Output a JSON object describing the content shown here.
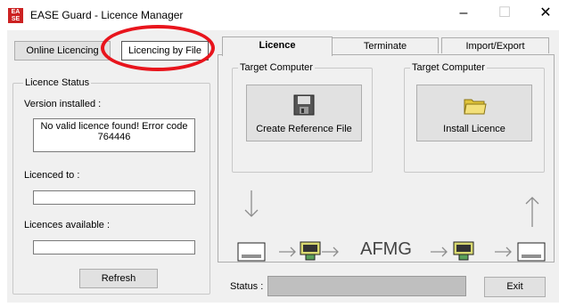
{
  "window": {
    "title": "EASE Guard - Licence Manager",
    "minimize": "–",
    "maximize": "☐",
    "close": "✕"
  },
  "mode_buttons": {
    "online": "Online Licencing",
    "file": "Licencing by File"
  },
  "licence_status": {
    "legend": "Licence Status",
    "version_label": "Version installed :",
    "version_value": "No valid licence found! Error code 764446",
    "licenced_to_label": "Licenced to :",
    "licenced_to_value": "",
    "available_label": "Licences available :",
    "available_value": "",
    "refresh_label": "Refresh"
  },
  "tabs": [
    "Licence",
    "Terminate",
    "Import/Export"
  ],
  "licence_panel": {
    "left_group_legend": "Target Computer",
    "right_group_legend": "Target Computer",
    "create_button_label": "Create Reference File",
    "install_button_label": "Install Licence",
    "flow_label": "AFMG"
  },
  "status": {
    "label": "Status :",
    "value": ""
  },
  "exit_label": "Exit",
  "colors": {
    "highlight": "#e8141c",
    "status_bar": "#bfbfbf",
    "face": "#f0f0f0"
  }
}
